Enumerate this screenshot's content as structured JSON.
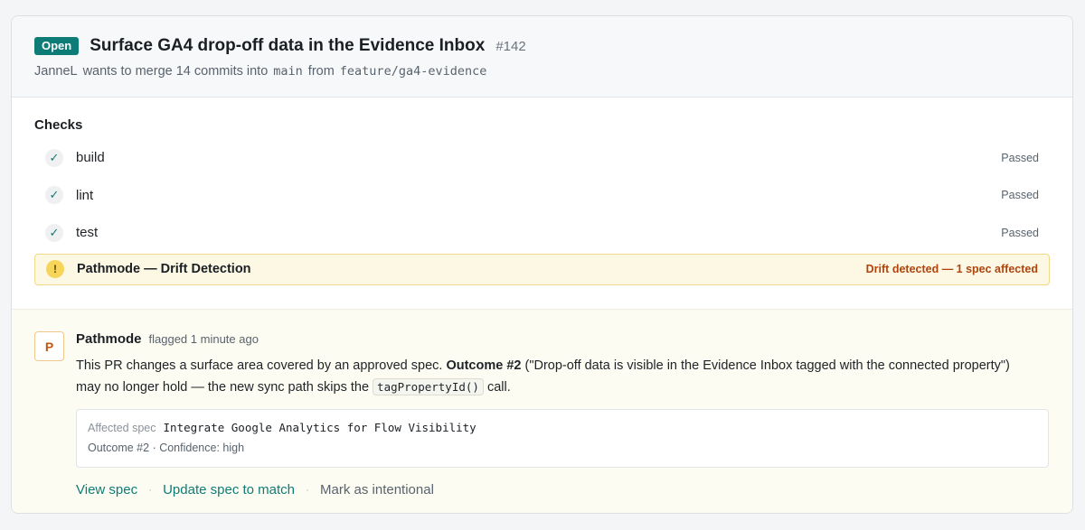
{
  "pr": {
    "status": "Open",
    "title": "Surface GA4 drop-off data in the Evidence Inbox",
    "number": "#142",
    "author": "JanneL",
    "merge_text_1": "wants to merge 14 commits into",
    "base_branch": "main",
    "merge_text_2": "from",
    "head_branch": "feature/ga4-evidence"
  },
  "checks": {
    "title": "Checks",
    "items": [
      {
        "name": "build",
        "status": "Passed"
      },
      {
        "name": "lint",
        "status": "Passed"
      },
      {
        "name": "test",
        "status": "Passed"
      }
    ],
    "drift": {
      "name": "Pathmode — Drift Detection",
      "status": "Drift detected — 1 spec affected"
    }
  },
  "comment": {
    "avatar_letter": "P",
    "author": "Pathmode",
    "meta": "flagged 1 minute ago",
    "text_1": "This PR changes a surface area covered by an approved spec.",
    "outcome": "Outcome #2",
    "text_2": "(\"Drop-off data is visible in the Evidence Inbox tagged with the connected property\") may no longer hold — the new sync path skips the",
    "code": "tagPropertyId()",
    "text_3": "call.",
    "spec": {
      "label": "Affected spec",
      "name": "Integrate Google Analytics for Flow Visibility",
      "meta": "Outcome #2 · Confidence: high"
    },
    "actions": {
      "view_spec": "View spec",
      "update_spec": "Update spec to match",
      "mark_intentional": "Mark as intentional",
      "separator": "·"
    }
  },
  "colors": {
    "accent": "#0e7c76",
    "warning_bg": "#fdf8e4",
    "warning_text": "#b0440c"
  }
}
